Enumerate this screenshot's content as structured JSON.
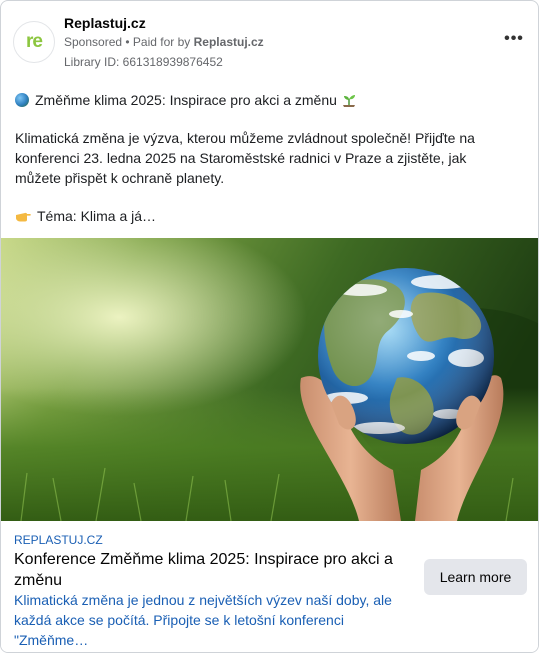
{
  "advertiser": {
    "name": "Replastuj.cz",
    "avatar_text": "re",
    "sponsored_label": "Sponsored",
    "paid_for_prefix": "• Paid for by",
    "paid_for_by": "Replastuj.cz",
    "library_id": "Library ID: 661318939876452",
    "brand_color": "#8cc63f"
  },
  "post": {
    "headline": "Změňme klima 2025: Inspirace pro akci a změnu",
    "paragraph": "Klimatická změna je výzva, kterou můžeme zvládnout společně! Přijďte na konferenci 23. ledna 2025 na Staroměstské radnici v Praze a zjistěte, jak můžete přispět k ochraně planety.",
    "theme_line": "Téma: Klima a já…",
    "icons": [
      "globe-emoji-icon",
      "seedling-emoji-icon",
      "pointing-hand-emoji-icon",
      "more-options-icon"
    ]
  },
  "link": {
    "domain": "REPLASTUJ.CZ",
    "title": "Konference Změňme klima 2025: Inspirace pro akci a změnu",
    "description": "Klimatická změna je jednou z největších výzev naší doby, ale každá akce se počítá. Připojte se k letošní konferenci \"Změňme…",
    "cta_label": "Learn more",
    "link_color": "#1a5fb4"
  }
}
